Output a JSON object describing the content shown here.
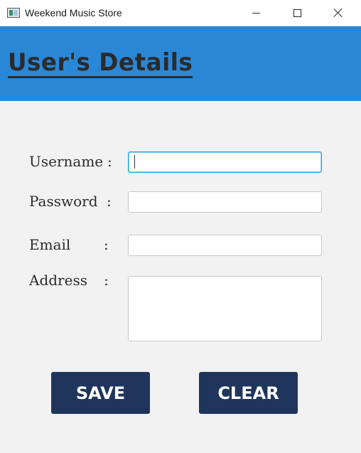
{
  "window": {
    "title": "Weekend Music Store",
    "icon": "app-window-icon",
    "controls": [
      "minimize-icon",
      "maximize-icon",
      "close-icon"
    ]
  },
  "header": {
    "title": "User's Details",
    "background_color": "#2a87d6"
  },
  "form": {
    "username": {
      "label": "Username",
      "colon": ":",
      "value": ""
    },
    "password": {
      "label": "Password",
      "colon": ":",
      "value": ""
    },
    "email": {
      "label": "Email",
      "colon": ":",
      "value": ""
    },
    "address": {
      "label": "Address",
      "colon": ":",
      "value": ""
    }
  },
  "actions": {
    "save_label": "SAVE",
    "clear_label": "CLEAR",
    "button_color": "#1f355c"
  }
}
